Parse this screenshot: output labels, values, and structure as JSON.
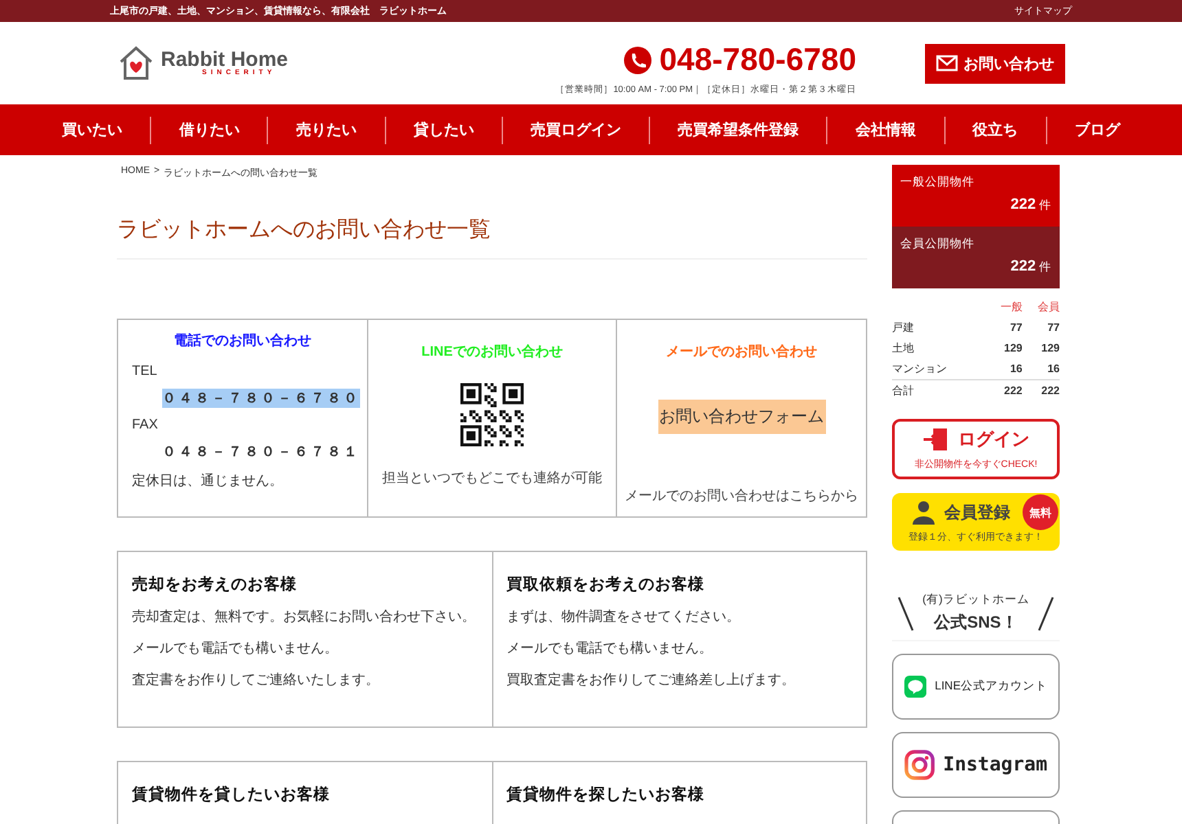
{
  "top_bar": {
    "tagline": "上尾市の戸建、土地、マンション、賃貸情報なら、有限会社　ラビットホーム",
    "sitemap_link": "サイトマップ"
  },
  "header": {
    "logo_name": "Rabbit Home",
    "logo_tagline": "SINCERITY",
    "phone": "048-780-6780",
    "hours": "［営業時間］10:00 AM - 7:00 PM｜［定休日］水曜日・第２第３木曜日",
    "contact_button": "お問い合わせ"
  },
  "nav": [
    "買いたい",
    "借りたい",
    "売りたい",
    "貸したい",
    "売買ログイン",
    "売買希望条件登録",
    "会社情報",
    "役立ち",
    "ブログ"
  ],
  "breadcrumb": {
    "home": "HOME",
    "separator": ">",
    "current": "ラビットホームへの問い合わせ一覧"
  },
  "page_title": "ラビットホームへのお問い合わせ一覧",
  "contact_methods": [
    {
      "kind": "phone",
      "heading": "電話でのお問い合わせ",
      "color": "#1a1aff",
      "tel_label": "TEL",
      "tel": "０４８－７８０－６７８０",
      "fax_label": "FAX",
      "fax": "０４８－７８０－６７８１",
      "note": "定休日は、通じません。"
    },
    {
      "kind": "line",
      "heading": "LINEでのお問い合わせ",
      "color": "#22ee22",
      "note": "担当といつでもどこでも連絡が可能"
    },
    {
      "kind": "mail",
      "heading": "メールでのお問い合わせ",
      "color": "#ff6a1a",
      "form_button": "お問い合わせフォーム",
      "note": "メールでのお問い合わせはこちらから"
    }
  ],
  "customer_boxes": [
    [
      {
        "heading": "売却をお考えのお客様",
        "lines": [
          "売却査定は、無料です。お気軽にお問い合わせ下さい。",
          "メールでも電話でも構いません。",
          "査定書をお作りしてご連絡いたします。"
        ]
      },
      {
        "heading": "買取依頼をお考えのお客様",
        "lines": [
          "まずは、物件調査をさせてください。",
          "メールでも電話でも構いません。",
          "買取査定書をお作りしてご連絡差し上げます。"
        ]
      }
    ],
    [
      {
        "heading": "賃貸物件を貸したいお客様"
      },
      {
        "heading": "賃貸物件を探したいお客様"
      }
    ]
  ],
  "sidebar": {
    "listings": [
      {
        "label": "一般公開物件",
        "count": "222",
        "unit": "件",
        "color": "#cc0000"
      },
      {
        "label": "会員公開物件",
        "count": "222",
        "unit": "件",
        "color": "#7f1a1f"
      }
    ],
    "stats": {
      "columns": [
        "一般",
        "会員"
      ],
      "rows": [
        {
          "label": "戸建",
          "values": [
            "77",
            "77"
          ]
        },
        {
          "label": "土地",
          "values": [
            "129",
            "129"
          ]
        },
        {
          "label": "マンション",
          "values": [
            "16",
            "16"
          ]
        }
      ],
      "total": {
        "label": "合計",
        "values": [
          "222",
          "222"
        ]
      }
    },
    "login": {
      "label": "ログイン",
      "sub": "非公開物件を今すぐCHECK!"
    },
    "register": {
      "label": "会員登録",
      "sub": "登録１分、すぐ利用できます！",
      "badge": "無料"
    },
    "sns": {
      "company": "(有)ラビットホーム",
      "title": "公式SNS！",
      "links": [
        {
          "kind": "line",
          "label": "LINE公式アカウント"
        },
        {
          "kind": "instagram",
          "label": "Instagram"
        },
        {
          "kind": "other"
        }
      ]
    }
  }
}
